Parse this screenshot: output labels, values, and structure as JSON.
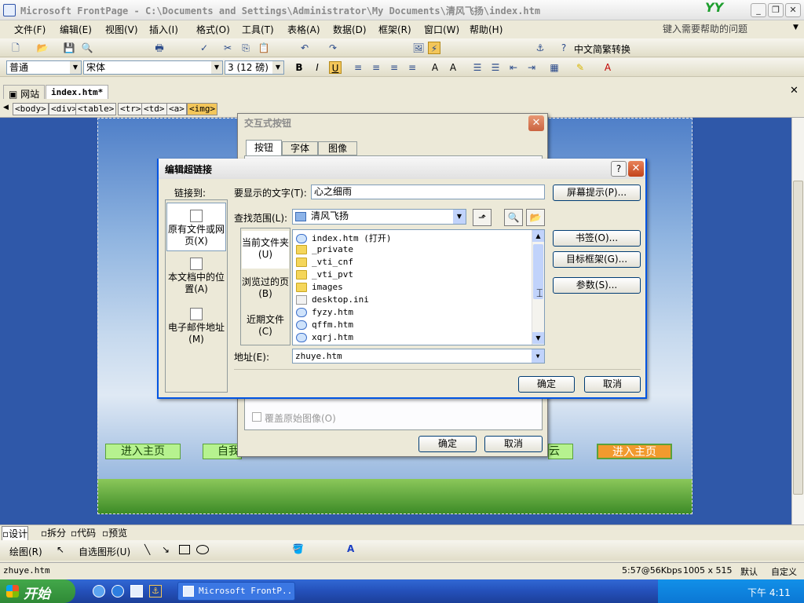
{
  "window": {
    "title": "Microsoft FrontPage - C:\\Documents and Settings\\Administrator\\My Documents\\清风飞扬\\index.htm",
    "logo": "YY"
  },
  "menu": [
    "文件(F)",
    "编辑(E)",
    "视图(V)",
    "插入(I)",
    "格式(O)",
    "工具(T)",
    "表格(A)",
    "数据(D)",
    "框架(R)",
    "窗口(W)",
    "帮助(H)"
  ],
  "help_placeholder": "键入需要帮助的问题",
  "toolbar1": {
    "convert_label": "中文简繁转换"
  },
  "toolbar2": {
    "style": "普通",
    "font": "宋体",
    "size": "3 (12 磅)",
    "bold": "B",
    "italic": "I",
    "underline": "U"
  },
  "tabs": {
    "site": "网站",
    "file": "index.htm*"
  },
  "tags": [
    "<body>",
    "<div>",
    "<table>",
    "<tr>",
    "<td>",
    "<a>",
    "<img>"
  ],
  "page_nav": {
    "btn1": "进入主页",
    "btn2": "自我",
    "btn3": "云",
    "btn4": "进入主页"
  },
  "views": [
    "设计",
    "拆分",
    "代码",
    "预览"
  ],
  "drawbar": {
    "draw": "绘图(R)",
    "autoshape": "自选图形(U)"
  },
  "status": {
    "file": "zhuye.htm",
    "speed": "5:57@56Kbps",
    "size": "1005 x 515",
    "default": "默认",
    "custom": "自定义"
  },
  "taskbar": {
    "start": "开始",
    "task": "Microsoft FrontP..",
    "time": "下午 4:11"
  },
  "btn_dialog": {
    "title": "交互式按钮",
    "tabs": [
      "按钮",
      "字体",
      "图像"
    ],
    "overwrite": "覆盖原始图像(O)",
    "ok": "确定",
    "cancel": "取消"
  },
  "link_dialog": {
    "title": "编辑超链接",
    "link_to": "链接到:",
    "display_text_label": "要显示的文字(T):",
    "display_text": "心之细雨",
    "screen_tip": "屏幕提示(P)...",
    "side": [
      {
        "label": "原有文件或网页(X)"
      },
      {
        "label": "本文档中的位置(A)"
      },
      {
        "label": "电子邮件地址(M)"
      }
    ],
    "lookin_label": "查找范围(L):",
    "lookin_value": "清风飞扬",
    "subnav": [
      "当前文件夹(U)",
      "浏览过的页(B)",
      "近期文件(C)"
    ],
    "files": [
      {
        "name": "index.htm (打开)",
        "type": "htm"
      },
      {
        "name": "_private",
        "type": "folder"
      },
      {
        "name": "_vti_cnf",
        "type": "folder"
      },
      {
        "name": "_vti_pvt",
        "type": "folder"
      },
      {
        "name": "images",
        "type": "folder"
      },
      {
        "name": "desktop.ini",
        "type": "ini"
      },
      {
        "name": "fyzy.htm",
        "type": "htm"
      },
      {
        "name": "qffm.htm",
        "type": "htm"
      },
      {
        "name": "xqrj.htm",
        "type": "htm"
      }
    ],
    "bookmark": "书签(O)...",
    "target_frame": "目标框架(G)...",
    "params": "参数(S)...",
    "address_label": "地址(E):",
    "address": "zhuye.htm",
    "ok": "确定",
    "cancel": "取消"
  }
}
